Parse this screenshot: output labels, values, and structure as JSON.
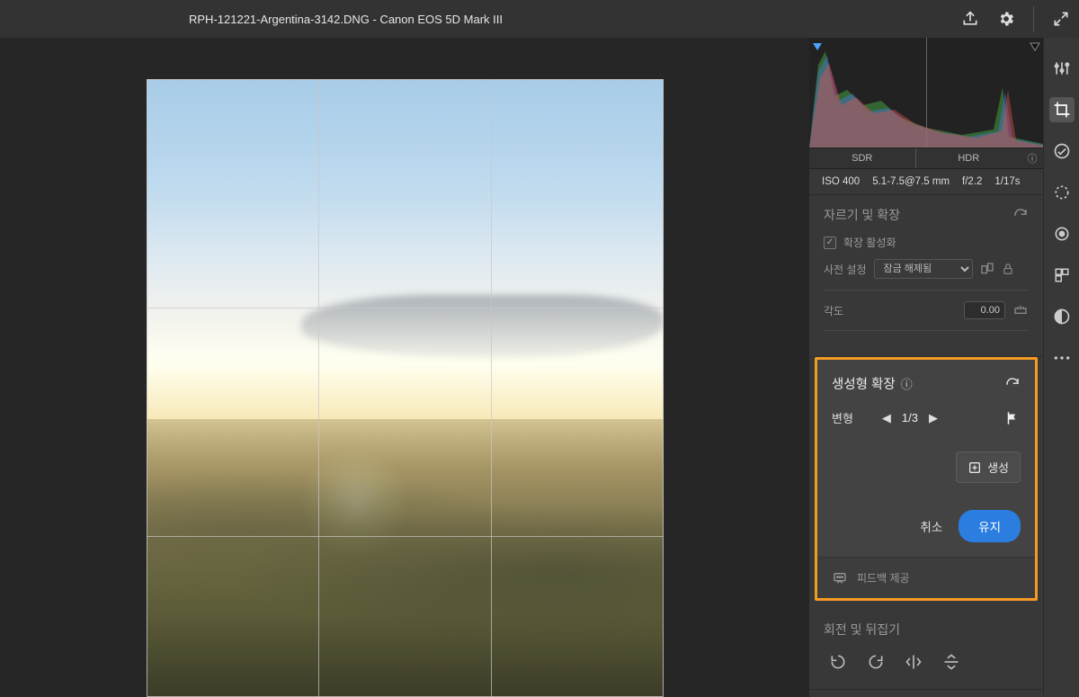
{
  "topbar": {
    "filename": "RPH-121221-Argentina-3142.DNG  -  Canon EOS 5D Mark III"
  },
  "histogram": {
    "sdr_label": "SDR",
    "hdr_label": "HDR"
  },
  "metadata": {
    "iso": "ISO 400",
    "focal": "5.1-7.5@7.5 mm",
    "aperture": "f/2.2",
    "shutter": "1/17s"
  },
  "crop_panel": {
    "title": "자르기 및 확장",
    "enable_expand": "확장 활성화",
    "preset_label": "사전 설정",
    "preset_value": "잠금 해제됨",
    "angle_label": "각도",
    "angle_value": "0.00"
  },
  "gen_panel": {
    "title": "생성형 확장",
    "variation_label": "변형",
    "variation_counter": "1/3",
    "generate": "생성",
    "cancel": "취소",
    "keep": "유지",
    "feedback": "피드백 제공"
  },
  "rotate_panel": {
    "title": "회전 및 뒤집기"
  }
}
